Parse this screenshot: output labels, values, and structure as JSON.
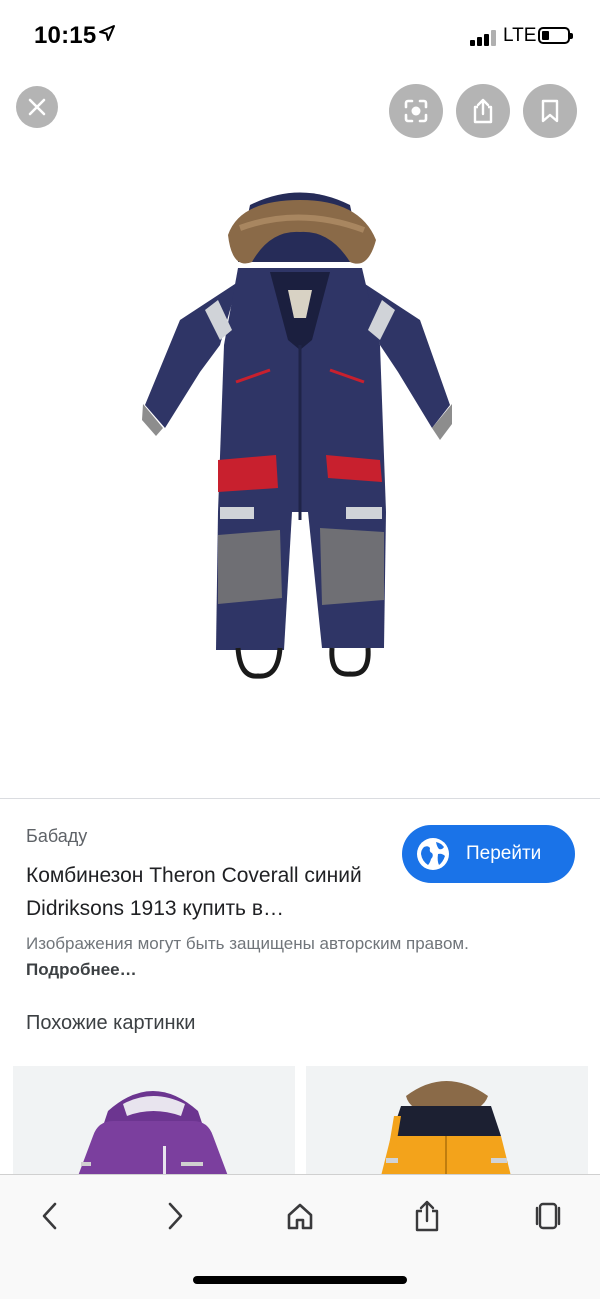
{
  "status_bar": {
    "time": "10:15",
    "network": "LTE"
  },
  "top_buttons": {
    "close": "close-icon",
    "lens": "lens-icon",
    "share": "share-icon",
    "save": "bookmark-icon"
  },
  "result": {
    "source": "Бабаду",
    "title": "Комбинезон Theron Coverall синий Didriksons 1913 купить в…",
    "goto_label": "Перейти",
    "copyright": "Изображения могут быть защищены авторским правом.",
    "more_link": "Подробнее…"
  },
  "similar": {
    "heading": "Похожие картинки"
  },
  "colors": {
    "accent": "#1a73e8",
    "jacket_navy": "#2f3566",
    "jacket_red": "#c8202e",
    "purple": "#7b3f9e",
    "yellow": "#f3a31b"
  },
  "toolbar": {
    "icons": [
      "back-icon",
      "forward-icon",
      "home-icon",
      "share-icon",
      "tabs-icon"
    ]
  }
}
